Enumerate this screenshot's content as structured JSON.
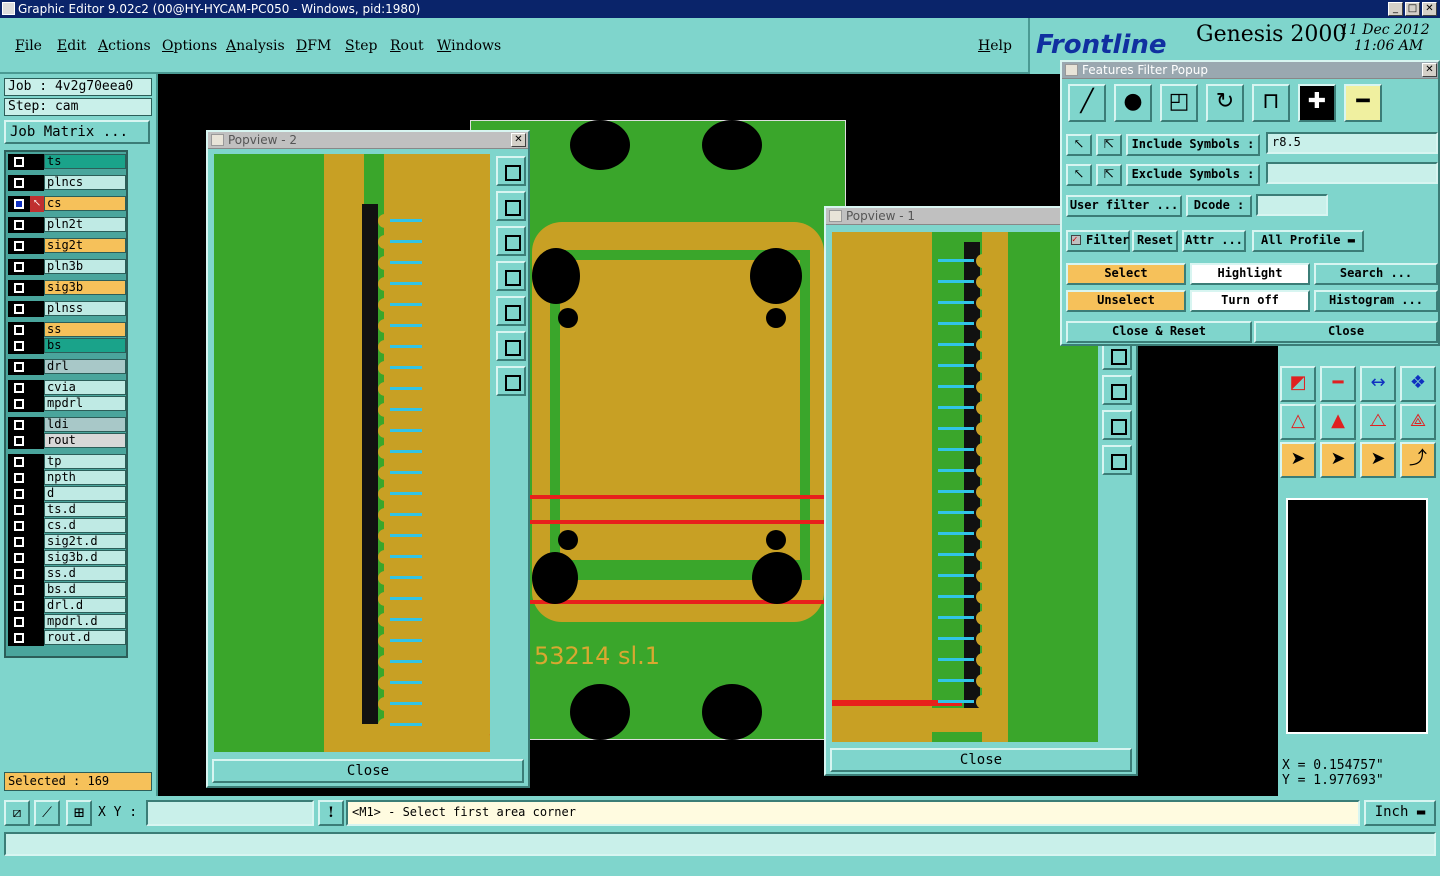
{
  "window": {
    "title": "Graphic Editor 9.02c2 (00@HY-HYCAM-PC050 - Windows, pid:1980)",
    "minimize": "_",
    "maximize": "□",
    "close": "✕"
  },
  "menu": {
    "items": [
      "File",
      "Edit",
      "Actions",
      "Options",
      "Analysis",
      "DFM",
      "Step",
      "Rout",
      "Windows"
    ],
    "help": "Help"
  },
  "brand": {
    "logo": "Frontline",
    "product": "Genesis 2000",
    "date": "11 Dec 2012",
    "time": "11:06 AM"
  },
  "left": {
    "job": "Job : 4v2g70eea0",
    "step": "Step: cam",
    "job_matrix": "Job Matrix ...",
    "selected": "Selected : 169",
    "layers": [
      {
        "name": "ts",
        "color": "#1aa38a"
      },
      {
        "name": "plncs",
        "color": "#bfeae4"
      },
      {
        "name": "cs",
        "color": "#f6c15a",
        "active": true
      },
      {
        "name": "pln2t",
        "color": "#bfeae4"
      },
      {
        "name": "sig2t",
        "color": "#f6c15a"
      },
      {
        "name": "pln3b",
        "color": "#bfeae4"
      },
      {
        "name": "sig3b",
        "color": "#f6c15a"
      },
      {
        "name": "plnss",
        "color": "#bfeae4"
      },
      {
        "name": "ss",
        "color": "#f6c15a"
      },
      {
        "name": "bs",
        "color": "#1aa38a"
      },
      {
        "name": "drl",
        "color": "#a8c8c8"
      },
      {
        "name": "cvia",
        "color": "#bfeae4"
      },
      {
        "name": "mpdrl",
        "color": "#bfeae4"
      },
      {
        "name": "ldi",
        "color": "#a8c8c8"
      },
      {
        "name": "rout",
        "color": "#d8d8d8"
      },
      {
        "name": "tp",
        "color": "#bfeae4"
      },
      {
        "name": "npth",
        "color": "#bfeae4"
      },
      {
        "name": "d",
        "color": "#bfeae4"
      },
      {
        "name": "ts.d",
        "color": "#bfeae4"
      },
      {
        "name": "cs.d",
        "color": "#bfeae4"
      },
      {
        "name": "sig2t.d",
        "color": "#bfeae4"
      },
      {
        "name": "sig3b.d",
        "color": "#bfeae4"
      },
      {
        "name": "ss.d",
        "color": "#bfeae4"
      },
      {
        "name": "bs.d",
        "color": "#bfeae4"
      },
      {
        "name": "drl.d",
        "color": "#bfeae4"
      },
      {
        "name": "mpdrl.d",
        "color": "#bfeae4"
      },
      {
        "name": "rout.d",
        "color": "#bfeae4"
      }
    ]
  },
  "canvas": {
    "board_text": "53214  sl.1"
  },
  "popview2": {
    "title": "Popview - 2",
    "close": "Close"
  },
  "popview1": {
    "title": "Popview - 1",
    "close": "Close"
  },
  "filter": {
    "title": "Features Filter Popup",
    "include_label": "Include Symbols :",
    "include_value": "r8.5",
    "exclude_label": "Exclude Symbols :",
    "exclude_value": "",
    "user_filter": "User filter ...",
    "dcode": "Dcode :",
    "dcode_value": "",
    "filter": "Filter",
    "reset": "Reset",
    "attr": "Attr ...",
    "profile": "All Profile",
    "select": "Select",
    "highlight": "Highlight",
    "search": "Search ...",
    "unselect": "Unselect",
    "turn_off": "Turn off",
    "histogram": "Histogram ...",
    "close_reset": "Close & Reset",
    "close": "Close"
  },
  "coords": {
    "x": "X = 0.154757\"",
    "y": "Y = 1.977693\""
  },
  "bottom": {
    "xy_label": "X Y :",
    "xy_value": "",
    "warn": "!",
    "status": "<M1> - Select first area corner",
    "units": "Inch"
  }
}
